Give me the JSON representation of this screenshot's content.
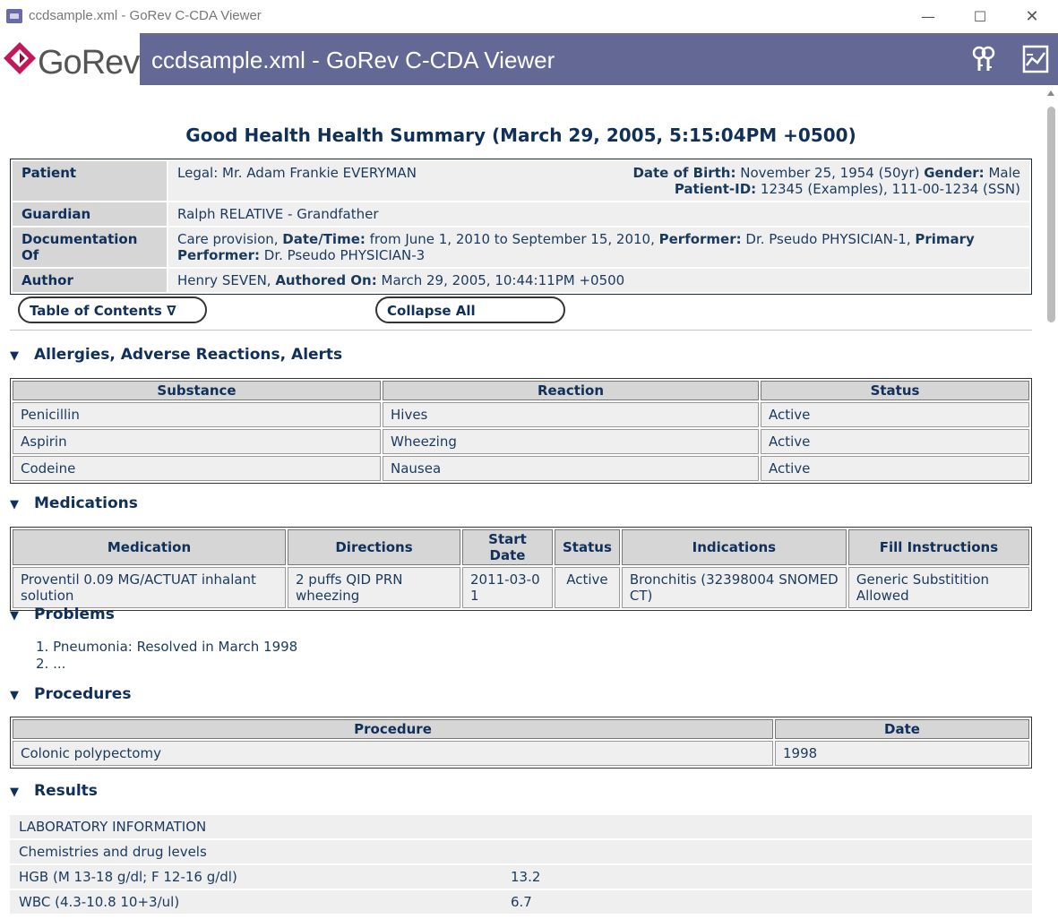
{
  "window": {
    "title": "ccdsample.xml - GoRev C-CDA Viewer",
    "minimize": "—",
    "maximize": "☐",
    "close": "✕"
  },
  "banner": {
    "logo_text": "GoRev",
    "title": "ccdsample.xml - GoRev C-CDA Viewer",
    "icons": [
      "keys-icon",
      "chart-report-icon"
    ]
  },
  "document": {
    "title": "Good Health Health Summary (March 29, 2005, 5:15:04PM +0500)",
    "header": {
      "patient_label": "Patient",
      "patient_name_prefix": "Legal: ",
      "patient_name": "Mr. Adam Frankie EVERYMAN",
      "dob_label": "Date of Birth:",
      "dob_value": " November 25, 1954 (50yr) ",
      "gender_label": "Gender:",
      "gender_value": " Male",
      "patient_id_label": "Patient-ID:",
      "patient_id_value": "  12345 (Examples), 111-00-1234 (SSN)",
      "guardian_label": "Guardian",
      "guardian_value": "Ralph RELATIVE - Grandfather",
      "docof_label": "Documentation Of",
      "docof_text1": "Care provision, ",
      "docof_dt_label": "Date/Time:",
      "docof_dt_value": " from June 1, 2010 to September 15, 2010, ",
      "docof_perf_label": "Performer:",
      "docof_perf_value": " Dr. Pseudo PHYSICIAN-1, ",
      "docof_primary_label": "Primary Performer:",
      "docof_primary_value": " Dr. Pseudo PHYSICIAN-3",
      "author_label": "Author",
      "author_name": "Henry SEVEN, ",
      "authored_on_label": "Authored On:",
      "authored_on_value": " March 29, 2005, 10:44:11PM +0500"
    },
    "buttons": {
      "toc": "Table of Contents ∇",
      "collapse": "Collapse All"
    }
  },
  "sections": {
    "allergies": {
      "title": "Allergies, Adverse Reactions, Alerts",
      "headers": [
        "Substance",
        "Reaction",
        "Status"
      ],
      "rows": [
        [
          "Penicillin",
          "Hives",
          "Active"
        ],
        [
          "Aspirin",
          "Wheezing",
          "Active"
        ],
        [
          "Codeine",
          "Nausea",
          "Active"
        ]
      ]
    },
    "medications": {
      "title": "Medications",
      "headers": [
        "Medication",
        "Directions",
        "Start Date",
        "Status",
        "Indications",
        "Fill Instructions"
      ],
      "rows": [
        [
          "Proventil 0.09 MG/ACTUAT inhalant solution",
          "2 puffs QID PRN wheezing",
          "2011-03-01",
          "Active",
          "Bronchitis (32398004 SNOMED CT)",
          "Generic Substitition Allowed"
        ]
      ]
    },
    "problems": {
      "title": "Problems",
      "items": [
        "1. Pneumonia: Resolved in March 1998",
        "2. ..."
      ]
    },
    "procedures": {
      "title": "Procedures",
      "headers": [
        "Procedure",
        "Date"
      ],
      "rows": [
        [
          "Colonic polypectomy",
          "1998"
        ]
      ]
    },
    "results": {
      "title": "Results",
      "rows": [
        [
          "LABORATORY INFORMATION",
          ""
        ],
        [
          "Chemistries and drug levels",
          ""
        ],
        [
          "HGB (M 13-18 g/dl; F 12-16 g/dl)",
          "13.2"
        ],
        [
          "WBC (4.3-10.8 10+3/ul)",
          "6.7"
        ]
      ]
    }
  }
}
